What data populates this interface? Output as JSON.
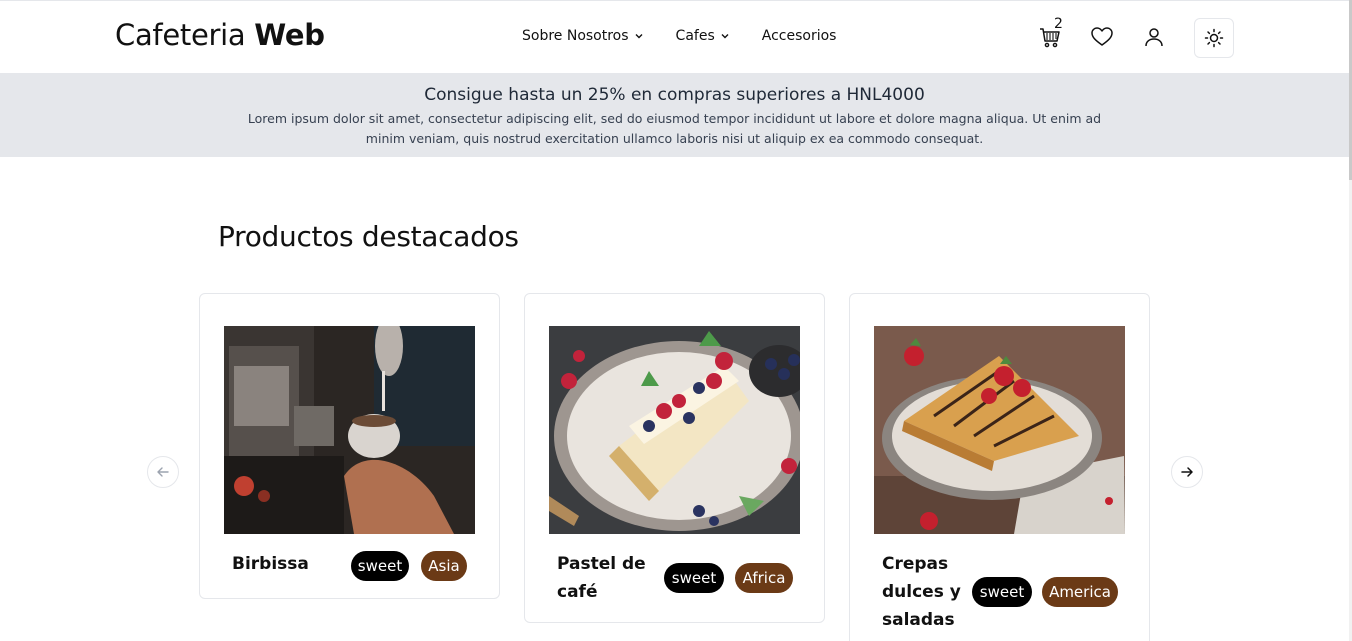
{
  "header": {
    "logo_light": "Cafeteria",
    "logo_bold": "Web",
    "nav": [
      {
        "label": "Sobre Nosotros",
        "has_dropdown": true
      },
      {
        "label": "Cafes",
        "has_dropdown": true
      },
      {
        "label": "Accesorios",
        "has_dropdown": false
      }
    ],
    "cart_count": "2",
    "icons": [
      "cart-icon",
      "heart-icon",
      "user-icon",
      "sun-icon"
    ]
  },
  "promo": {
    "title": "Consigue hasta un 25% en compras superiores a HNL4000",
    "text": "Lorem ipsum dolor sit amet, consectetur adipiscing elit, sed do eiusmod tempor incididunt ut labore et dolore magna aliqua. Ut enim ad minim veniam, quis nostrud exercitation ullamco laboris nisi ut aliquip ex ea commodo consequat."
  },
  "featured": {
    "title": "Productos destacados",
    "products": [
      {
        "name_lines": [
          "Birbissa"
        ],
        "tags": [
          "sweet",
          "Asia"
        ]
      },
      {
        "name_lines": [
          "Pastel de",
          "café"
        ],
        "tags": [
          "sweet",
          "Africa"
        ]
      },
      {
        "name_lines": [
          "Crepas",
          "dulces y",
          "saladas"
        ],
        "tags": [
          "sweet",
          "America"
        ]
      }
    ]
  },
  "colors": {
    "banner_bg": "#e5e7eb",
    "tag_dark": "#000000",
    "tag_brown": "#6b3a16"
  }
}
